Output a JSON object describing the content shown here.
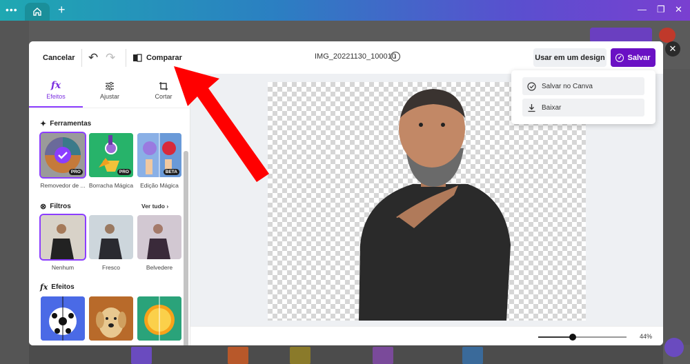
{
  "browser": {
    "menu_icon": "ellipsis-icon",
    "home_icon": "home-icon",
    "new_tab_icon": "plus-icon",
    "controls": [
      "minimize-icon",
      "restore-icon",
      "close-icon"
    ]
  },
  "header": {
    "cancel_label": "Cancelar",
    "compare_label": "Comparar",
    "file_title": "IMG_20221130_100010",
    "use_in_design_label": "Usar em um design",
    "save_label": "Salvar"
  },
  "tabs": [
    {
      "label": "Efeitos",
      "icon": "fx-icon",
      "active": true
    },
    {
      "label": "Ajustar",
      "icon": "sliders-icon",
      "active": false
    },
    {
      "label": "Cortar",
      "icon": "crop-icon",
      "active": false
    }
  ],
  "sections": {
    "tools": {
      "title": "Ferramentas",
      "items": [
        {
          "label": "Removedor de ...",
          "badge": "PRO"
        },
        {
          "label": "Borracha Mágica",
          "badge": "PRO"
        },
        {
          "label": "Edição Mágica",
          "badge": "BETA"
        }
      ]
    },
    "filters": {
      "title": "Filtros",
      "see_all_label": "Ver tudo",
      "items": [
        {
          "label": "Nenhum"
        },
        {
          "label": "Fresco"
        },
        {
          "label": "Belvedere"
        }
      ]
    },
    "effects": {
      "title": "Efeitos"
    }
  },
  "save_menu": {
    "items": [
      {
        "label": "Salvar no Canva",
        "icon": "check-circle-icon"
      },
      {
        "label": "Baixar",
        "icon": "download-icon"
      }
    ]
  },
  "zoom": {
    "label": "44%",
    "value": 0.44
  },
  "colors": {
    "accent": "#8b3dff",
    "save_button": "#6a11c4",
    "annotation_arrow": "#ff0000"
  }
}
